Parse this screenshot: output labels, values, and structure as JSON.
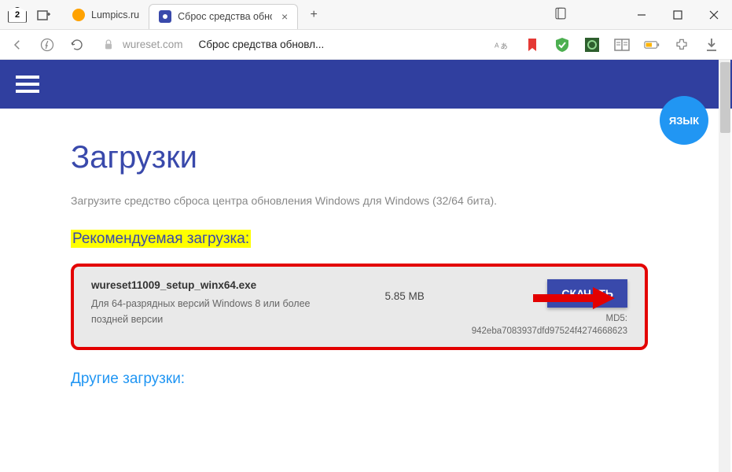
{
  "browser": {
    "home_badge": "2",
    "tabs": [
      {
        "label": "Lumpics.ru",
        "active": false
      },
      {
        "label": "Сброс средства обновл",
        "active": true
      }
    ],
    "domain": "wureset.com",
    "page_title_in_addr": "Сброс средства обновл..."
  },
  "site": {
    "lang_badge": "ЯЗЫК",
    "heading": "Загрузки",
    "subtitle": "Загрузите средство сброса центра обновления Windows для Windows (32/64 бита).",
    "recommended_heading": "Рекомендуемая загрузка:",
    "download": {
      "filename": "wureset11009_setup_winx64.exe",
      "description": "Для 64-разрядных версий Windows 8 или более поздней версии",
      "size": "5.85 MB",
      "button": "СКАЧАТЬ",
      "md5_label": "MD5:",
      "md5_value": "942eba7083937dfd97524f4274668623"
    },
    "other_heading": "Другие загрузки:"
  }
}
